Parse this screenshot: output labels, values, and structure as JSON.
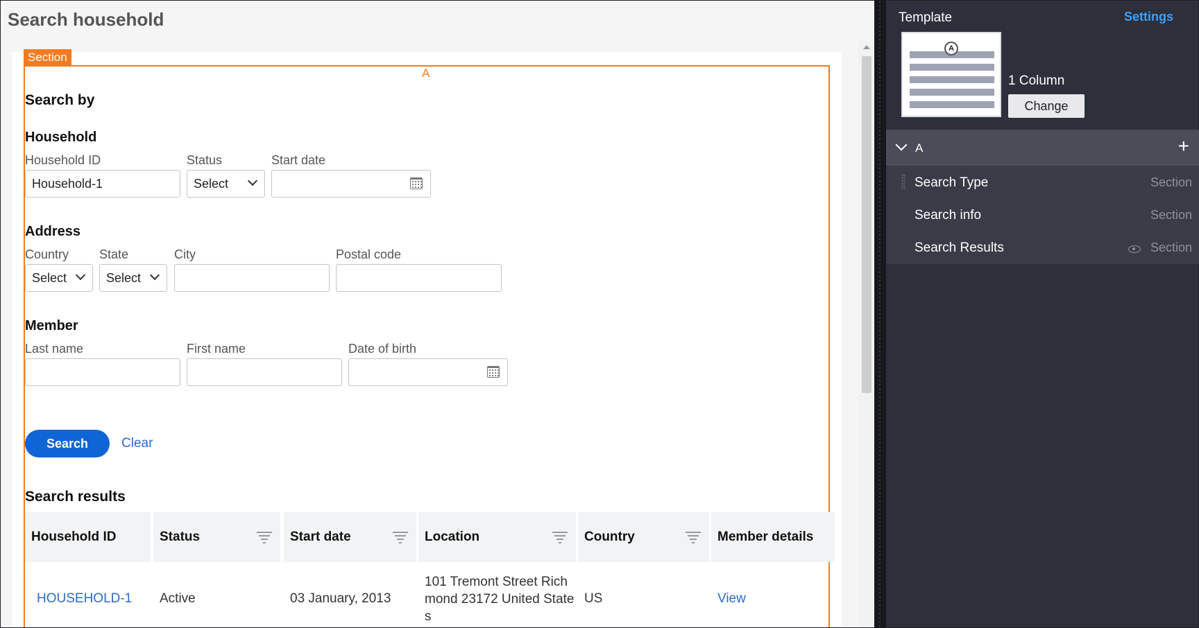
{
  "page": {
    "title": "Search household"
  },
  "section": {
    "tag": "Section",
    "region": "A"
  },
  "form": {
    "heading": "Search by",
    "household": {
      "heading": "Household",
      "id_label": "Household ID",
      "id_value": "Household-1",
      "status_label": "Status",
      "status_value": "Select",
      "start_date_label": "Start date",
      "start_date_value": ""
    },
    "address": {
      "heading": "Address",
      "country_label": "Country",
      "country_value": "Select",
      "state_label": "State",
      "state_value": "Select",
      "city_label": "City",
      "city_value": "",
      "postal_label": "Postal code",
      "postal_value": ""
    },
    "member": {
      "heading": "Member",
      "last_name_label": "Last name",
      "last_name_value": "",
      "first_name_label": "First name",
      "first_name_value": "",
      "dob_label": "Date of birth",
      "dob_value": ""
    },
    "search_button": "Search",
    "clear_link": "Clear"
  },
  "results": {
    "heading": "Search results",
    "columns": [
      "Household ID",
      "Status",
      "Start date",
      "Location",
      "Country",
      "Member details"
    ],
    "rows": [
      {
        "household_id": "HOUSEHOLD-1",
        "status": "Active",
        "start_date": "03 January, 2013",
        "location_lines": [
          "101 Tremont Street Rich",
          "mond 23172 United State",
          "s"
        ],
        "country": "US",
        "member_details": "View"
      }
    ]
  },
  "panel": {
    "template_label": "Template",
    "settings_link": "Settings",
    "thumb_badge": "A",
    "layout_name": "1 Column",
    "change_button": "Change",
    "region_name": "A",
    "items": [
      {
        "name": "Search Type",
        "type": "Section"
      },
      {
        "name": "Search info",
        "type": "Section"
      },
      {
        "name": "Search Results",
        "type": "Section"
      }
    ]
  },
  "colors": {
    "accent": "#f47b20",
    "primary": "#1065d6",
    "link": "#2c6bc4",
    "panel_bg": "#2d2f3b",
    "settings": "#3ba0ff"
  }
}
